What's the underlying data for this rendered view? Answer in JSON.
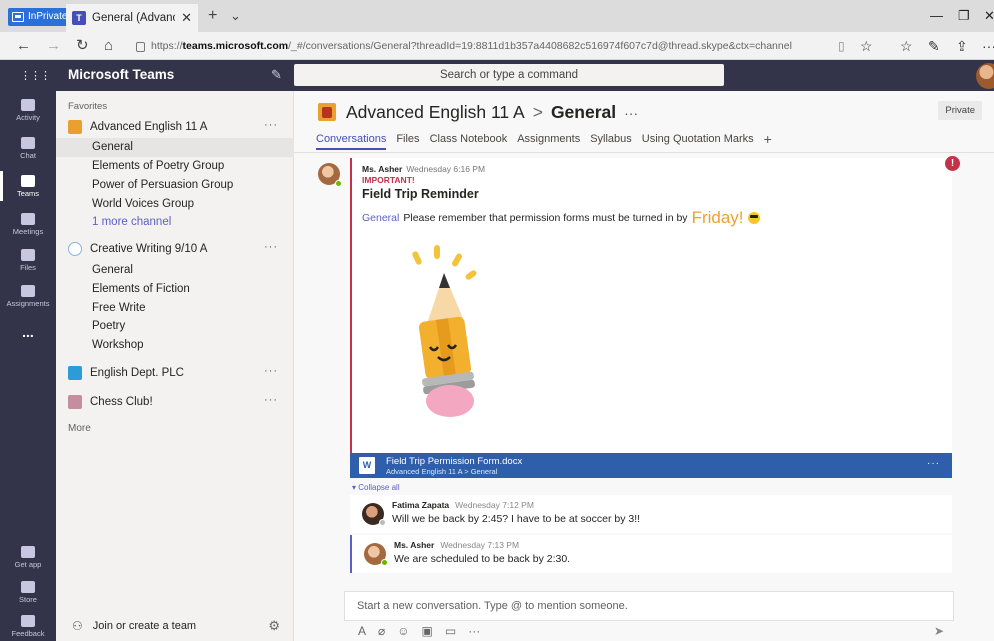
{
  "browser": {
    "inprivate": "InPrivate",
    "tab_title": "General (Advanced Engl",
    "tab_close": "✕",
    "new_tab": "+",
    "tab_menu": "⌄",
    "url_prefix": "https://",
    "url_host": "teams.microsoft.com",
    "url_path": "/_#/conversations/General?threadId=19:8811d1b357a4408682c516974f607c7d@thread.skype&ctx=channel"
  },
  "teams": {
    "brand": "Microsoft Teams",
    "search_placeholder": "Search or type a command"
  },
  "rail": {
    "items": [
      {
        "label": "Activity"
      },
      {
        "label": "Chat"
      },
      {
        "label": "Teams"
      },
      {
        "label": "Meetings"
      },
      {
        "label": "Files"
      },
      {
        "label": "Assignments"
      }
    ],
    "more": "...",
    "bottom": [
      {
        "label": "Get app"
      },
      {
        "label": "Store"
      },
      {
        "label": "Feedback"
      }
    ]
  },
  "left": {
    "favorites": "Favorites",
    "teams": [
      {
        "name": "Advanced English 11 A",
        "color": "#e8a02f",
        "channels": [
          "General",
          "Elements of Poetry Group",
          "Power of Persuasion Group",
          "World Voices Group"
        ],
        "more_channels": "1 more channel"
      },
      {
        "name": "Creative Writing 9/10 A",
        "color": "#88b3e0",
        "channels": [
          "General",
          "Elements of Fiction",
          "Free Write",
          "Poetry",
          "Workshop"
        ]
      },
      {
        "name": "English Dept. PLC",
        "color": "#2c9bd6"
      },
      {
        "name": "Chess Club!",
        "color": "#c58ea0"
      }
    ],
    "more": "More",
    "join": "Join or create a team",
    "dots": "···"
  },
  "channel": {
    "team": "Advanced English 11 A",
    "sep": ">",
    "name": "General",
    "more": "···",
    "private": "Private",
    "tabs": [
      "Conversations",
      "Files",
      "Class Notebook",
      "Assignments",
      "Syllabus",
      "Using Quotation Marks"
    ],
    "add_tab": "+"
  },
  "post": {
    "author": "Ms. Asher",
    "time": "Wednesday 6:16 PM",
    "important": "IMPORTANT!",
    "subject": "Field Trip Reminder",
    "mention": "General",
    "body": "Please remember that permission forms must be turned in by",
    "emphasis": "Friday!",
    "important_badge": "!",
    "attachment": {
      "name": "Field Trip Permission Form.docx",
      "path": "Advanced English 11 A > General",
      "icon": "W"
    },
    "collapse": "Collapse all"
  },
  "replies": [
    {
      "author": "Fatima Zapata",
      "time": "Wednesday 7:12 PM",
      "text": "Will we be back by 2:45? I have to be at soccer by 3!!"
    },
    {
      "author": "Ms. Asher",
      "time": "Wednesday 7:13 PM",
      "text": "We are scheduled to be back by 2:30."
    }
  ],
  "compose": {
    "placeholder": "Start a new conversation. Type @ to mention someone."
  }
}
